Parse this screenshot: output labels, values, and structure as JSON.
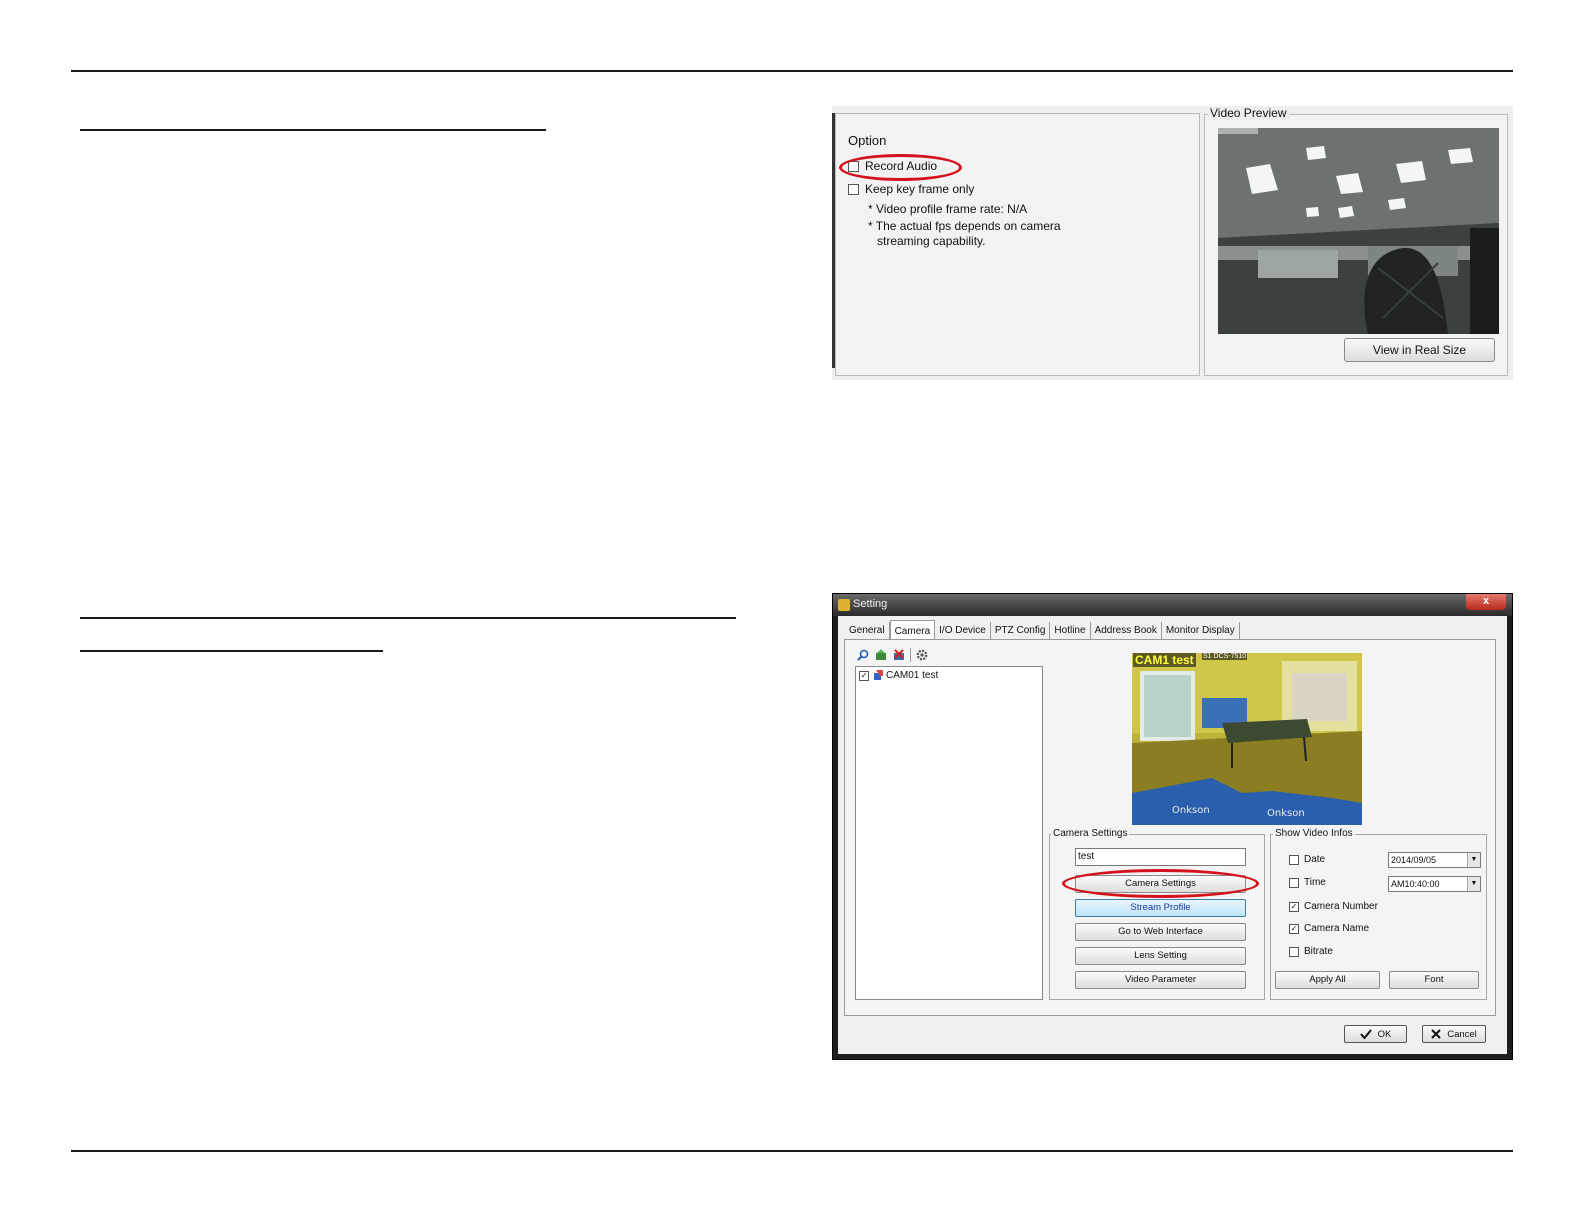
{
  "top_panel": {
    "option_title": "Option",
    "record_audio_label": "Record Audio",
    "keep_key_frame_label": "Keep key frame only",
    "note_frame_rate": "* Video profile frame rate: N/A",
    "note_fps_line1": "* The actual fps depends on camera",
    "note_fps_line2": "streaming capability.",
    "video_preview_label": "Video Preview",
    "view_real_size_button": "View in Real Size"
  },
  "dialog": {
    "title": "Setting",
    "close_label": "x",
    "tabs": [
      "General",
      "Camera",
      "I/O Device",
      "PTZ Config",
      "Hotline",
      "Address Book",
      "Monitor Display"
    ],
    "tree_item": "CAM01 test",
    "osd_camera_name": "CAM1 test",
    "osd_model": "S1 DCS-7510",
    "camera_settings_group": "Camera Settings",
    "camera_name_value": "test",
    "buttons": {
      "camera_settings": "Camera Settings",
      "stream_profile": "Stream Profile",
      "web_interface": "Go to Web Interface",
      "lens_setting": "Lens Setting",
      "video_parameter": "Video Parameter"
    },
    "show_video_infos_group": "Show Video Infos",
    "infos": {
      "date_label": "Date",
      "date_value": "2014/09/05",
      "time_label": "Time",
      "time_value": "AM10:40:00",
      "camera_number_label": "Camera Number",
      "camera_name_label": "Camera Name",
      "bitrate_label": "Bitrate",
      "apply_all": "Apply All",
      "font": "Font"
    },
    "ok": "OK",
    "cancel": "Cancel"
  },
  "colors": {
    "highlight_oval": "#d4121e",
    "stream_profile_blue": "#1a3aa0"
  },
  "icons": [
    "search-icon",
    "add-camera-icon",
    "delete-camera-icon",
    "settings-gear-icon",
    "camera-icon",
    "check-icon",
    "cross-icon",
    "dropdown-arrow-icon"
  ]
}
